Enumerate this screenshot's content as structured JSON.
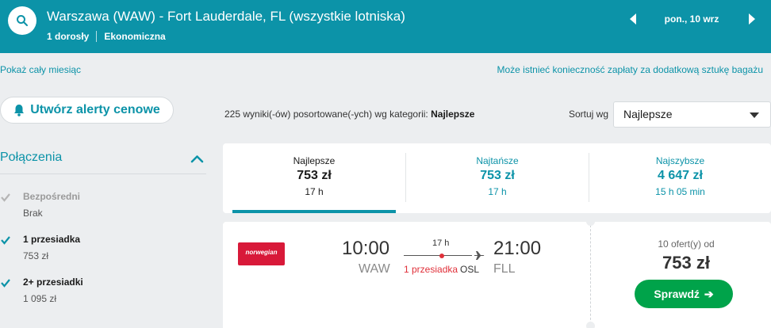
{
  "header": {
    "route": "Warszawa (WAW) - Fort Lauderdale, FL (wszystkie lotniska)",
    "passengers": "1 dorosły",
    "cabin": "Ekonomiczna",
    "date": "pon., 10 wrz",
    "icons": {
      "search": "search-icon",
      "prev": "chevron-left-icon",
      "next": "chevron-right-icon"
    }
  },
  "links": {
    "show_month": "Pokaż cały miesiąc",
    "baggage_notice": "Może istnieć konieczność zapłaty za dodatkową sztukę bagażu"
  },
  "alert_button": {
    "label": "Utwórz alerty cenowe",
    "icon": "bell-icon"
  },
  "filters": {
    "title": "Połączenia",
    "items": [
      {
        "label": "Bezpośredni",
        "price": "Brak",
        "checked": true,
        "disabled": true
      },
      {
        "label": "1 przesiadka",
        "price": "753 zł",
        "checked": true,
        "disabled": false
      },
      {
        "label": "2+ przesiadki",
        "price": "1 095 zł",
        "checked": true,
        "disabled": false
      }
    ]
  },
  "results": {
    "count_text": "225 wyniki(-ów) posortowane(-ych) wg kategorii: ",
    "sort_category": "Najlepsze",
    "sort_label": "Sortuj wg",
    "sort_value": "Najlepsze"
  },
  "tabs": [
    {
      "title": "Najlepsze",
      "price": "753 zł",
      "duration": "17 h",
      "active": true
    },
    {
      "title": "Najtańsze",
      "price": "753 zł",
      "duration": "17 h",
      "active": false
    },
    {
      "title": "Najszybsze",
      "price": "4 647 zł",
      "duration": "15 h 05 min",
      "active": false
    }
  ],
  "result": {
    "airline": "norwegian",
    "departure_time": "10:00",
    "departure_code": "WAW",
    "arrival_time": "21:00",
    "arrival_code": "FLL",
    "duration": "17 h",
    "stops": "1 przesiadka",
    "via": "OSL",
    "offers": "10 ofert(y) od",
    "price": "753 zł",
    "button": "Sprawdź",
    "button_arrow": "➔"
  },
  "colors": {
    "brand": "#0c93a8",
    "cta": "#00a34a",
    "stop_red": "#e0303a",
    "airline_red": "#d81939"
  }
}
